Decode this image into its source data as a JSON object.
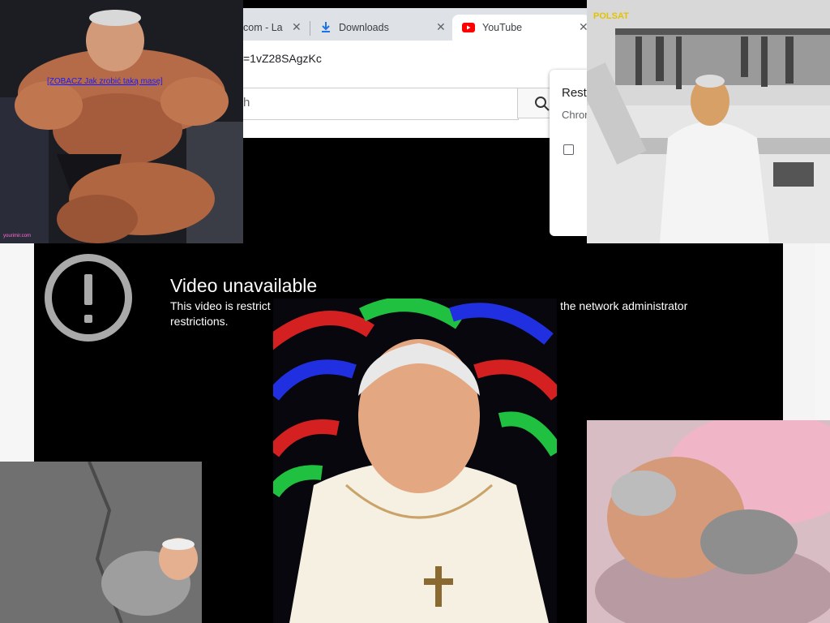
{
  "browser": {
    "tabs": [
      {
        "title": "com - La",
        "close": "✕"
      },
      {
        "title": "Downloads",
        "close": "✕"
      },
      {
        "title": "YouTube",
        "close": "✕"
      }
    ],
    "url": "=1vZ28SAgzKc",
    "search_placeholder": "h",
    "restore_popup": {
      "title": "Resto",
      "subtitle": "Chror"
    }
  },
  "video_error": {
    "title": "Video unavailable",
    "line1_start": "This video is restrict",
    "line1_end": "and/or the network administrator",
    "line2": "restrictions."
  },
  "overlay_images": {
    "bodybuilder": {
      "link_text": "[ZOBACZ Jak zrobić taką masę]",
      "credit": "yourimir.com"
    },
    "kitchen": {
      "logo": "POLSAT"
    }
  },
  "colors": {
    "youtube_red": "#ff0000",
    "link_blue": "#1a1aff",
    "warning_gray": "#a9a9a9"
  }
}
